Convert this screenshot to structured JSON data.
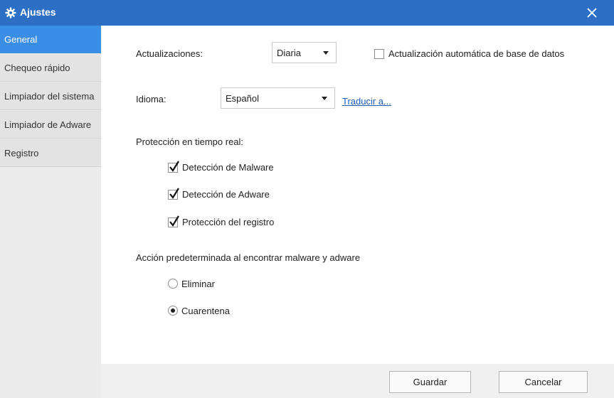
{
  "window": {
    "title": "Ajustes",
    "title_icon": "gear-icon",
    "close_icon": "close-icon",
    "accent_color": "#2d6fc4"
  },
  "sidebar": {
    "active_color": "#3b8ee5",
    "items": [
      {
        "label": "General",
        "active": true
      },
      {
        "label": "Chequeo rápido",
        "active": false
      },
      {
        "label": "Limpiador del sistema",
        "active": false
      },
      {
        "label": "Limpiador de Adware",
        "active": false
      },
      {
        "label": "Registro",
        "active": false
      }
    ]
  },
  "general": {
    "updates": {
      "label": "Actualizaciones:",
      "selected": "Diaria"
    },
    "auto_db_update": {
      "label": "Actualización automática de base de datos",
      "checked": false
    },
    "language": {
      "label": "Idioma:",
      "selected": "Español",
      "translate_link": "Traducir a..."
    },
    "realtime": {
      "heading": "Protección en tiempo real:",
      "options": [
        {
          "label": "Detección de Malware",
          "checked": true
        },
        {
          "label": "Detección de Adware",
          "checked": true
        },
        {
          "label": "Protección del registro",
          "checked": true
        }
      ]
    },
    "default_action": {
      "heading": "Acción predeterminada al encontrar malware y adware",
      "options": [
        {
          "label": "Eliminar",
          "selected": false
        },
        {
          "label": "Cuarentena",
          "selected": true
        }
      ]
    }
  },
  "footer": {
    "save_label": "Guardar",
    "cancel_label": "Cancelar"
  }
}
